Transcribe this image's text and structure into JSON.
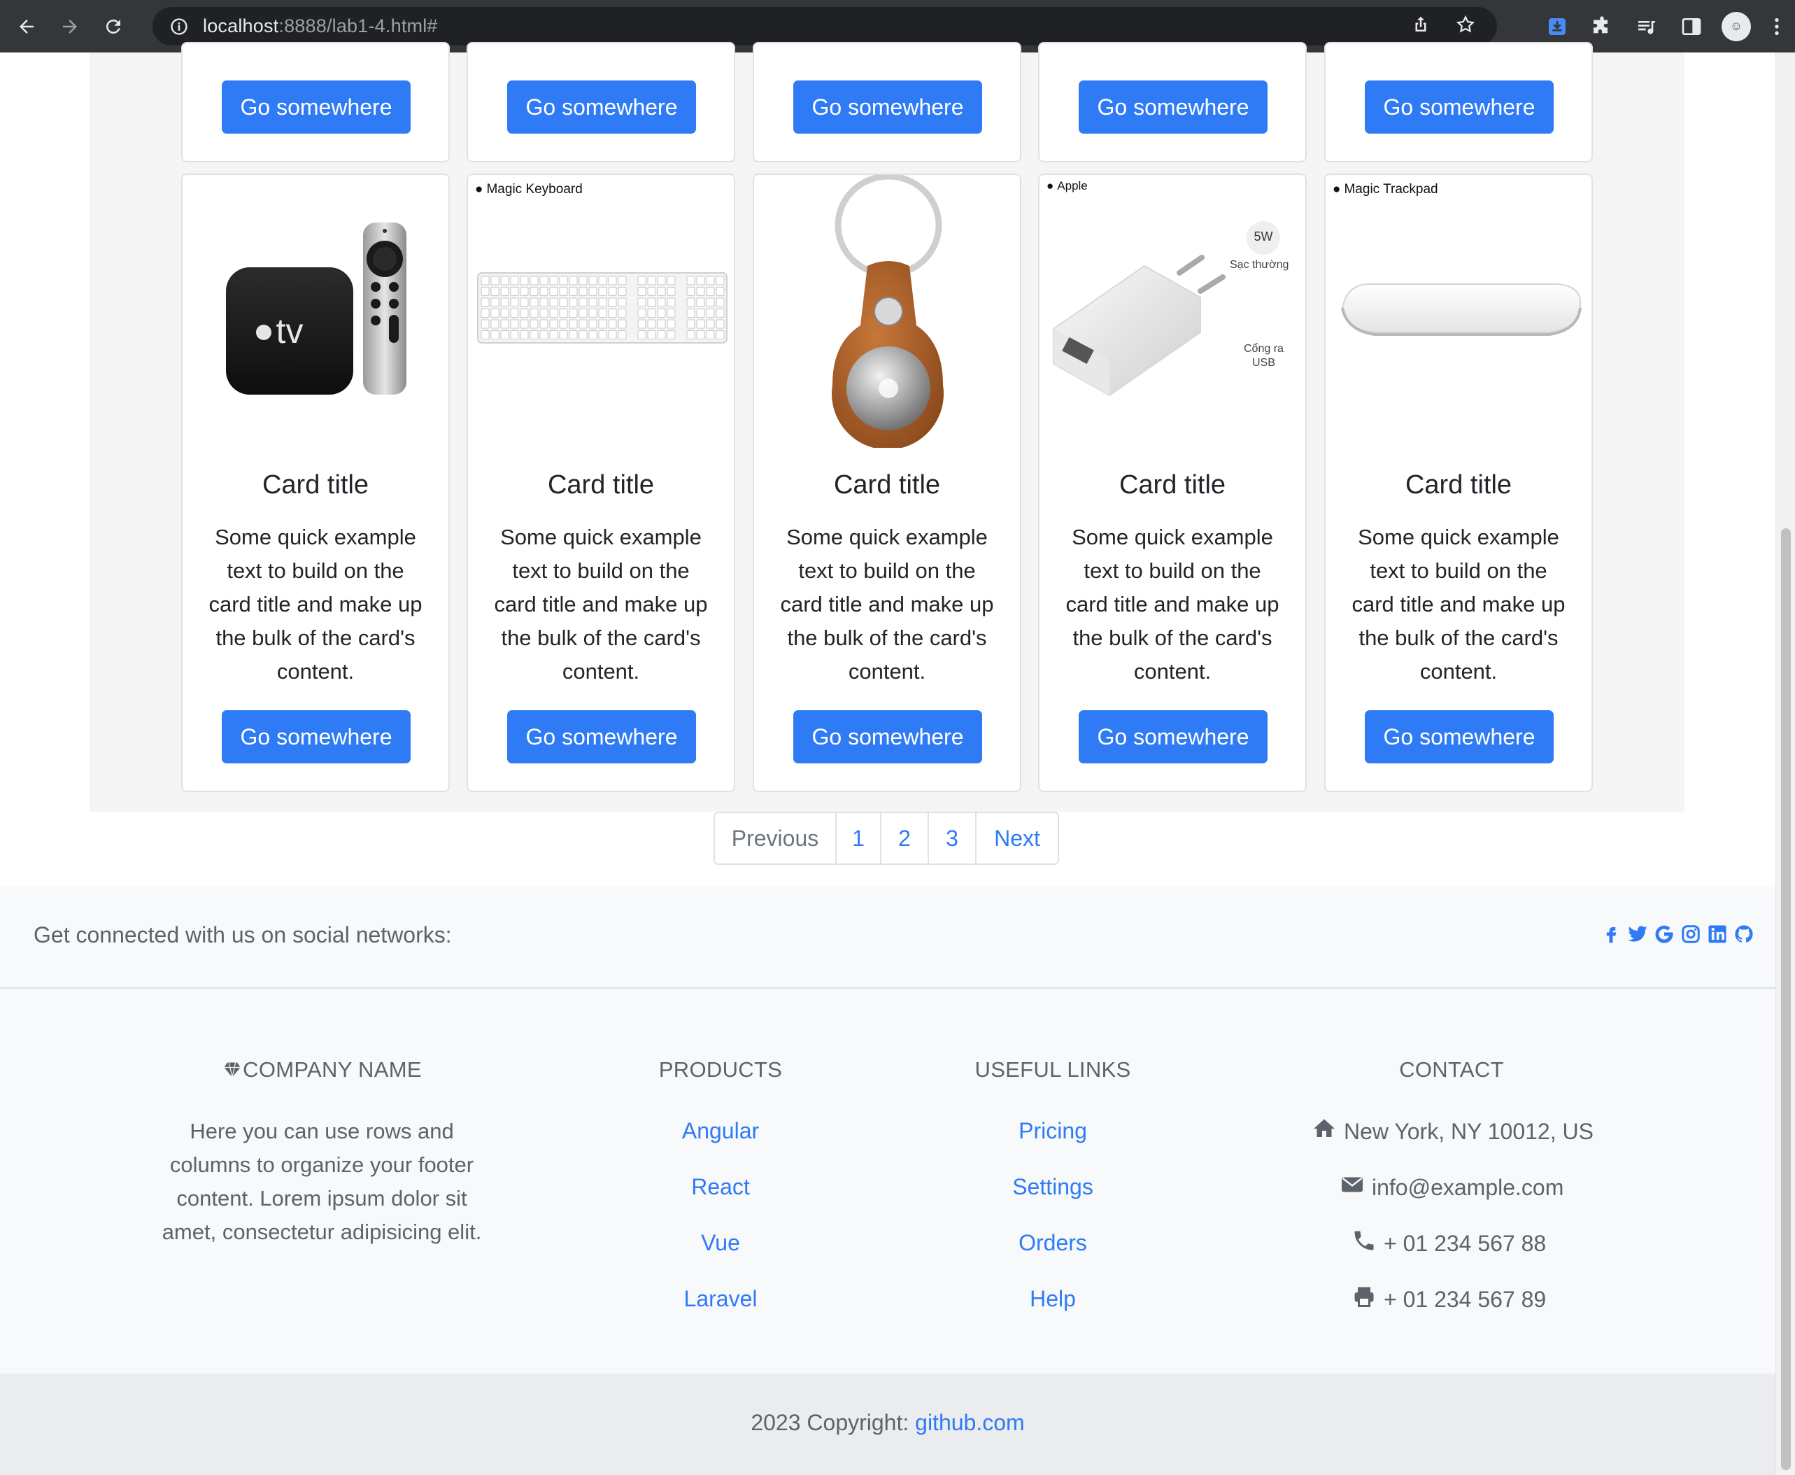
{
  "browser": {
    "url_host": "localhost",
    "url_path": ":8888/lab1-4.html#",
    "icons": [
      "back-icon",
      "forward-icon",
      "reload-icon",
      "info-icon",
      "share-icon",
      "bookmark-star-icon",
      "download-icon",
      "extensions-icon",
      "media-icon",
      "side-panel-icon",
      "profile-avatar",
      "menu-icon"
    ]
  },
  "cards_top_row": {
    "button_label": "Go somewhere"
  },
  "cards": [
    {
      "image": "apple-tv",
      "image_label": "",
      "title": "Card title",
      "text": "Some quick example text to build on the card title and make up the bulk of the card's content.",
      "button": "Go somewhere"
    },
    {
      "image": "magic-keyboard",
      "image_label": "Magic Keyboard",
      "title": "Card title",
      "text": "Some quick example text to build on the card title and make up the bulk of the card's content.",
      "button": "Go somewhere"
    },
    {
      "image": "airtag-keyring",
      "image_label": "",
      "title": "Card title",
      "text": "Some quick example text to build on the card title and make up the bulk of the card's content.",
      "button": "Go somewhere"
    },
    {
      "image": "usb-charger",
      "image_label": "Apple",
      "title": "Card title",
      "text": "Some quick example text to build on the card title and make up the bulk of the card's content.",
      "button": "Go somewhere",
      "charger_badge": "5W",
      "charger_note1": "Sạc thường",
      "charger_note2a": "Cổng ra",
      "charger_note2b": "USB"
    },
    {
      "image": "magic-trackpad",
      "image_label": "Magic Trackpad",
      "title": "Card title",
      "text": "Some quick example text to build on the card title and make up the bulk of the card's content.",
      "button": "Go somewhere"
    }
  ],
  "appletv_logo_text": "tv",
  "pagination": {
    "previous": "Previous",
    "pages": [
      "1",
      "2",
      "3"
    ],
    "next": "Next"
  },
  "footer": {
    "social_text": "Get connected with us on social networks:",
    "social_icons": [
      "facebook-icon",
      "twitter-icon",
      "google-icon",
      "instagram-icon",
      "linkedin-icon",
      "github-icon"
    ],
    "company": {
      "heading": "COMPANY NAME",
      "text": "Here you can use rows and columns to organize your footer content. Lorem ipsum dolor sit amet, consectetur adipisicing elit."
    },
    "products": {
      "heading": "PRODUCTS",
      "links": [
        "Angular",
        "React",
        "Vue",
        "Laravel"
      ]
    },
    "useful_links": {
      "heading": "USEFUL LINKS",
      "links": [
        "Pricing",
        "Settings",
        "Orders",
        "Help"
      ]
    },
    "contact": {
      "heading": "CONTACT",
      "address": "New York, NY 10012, US",
      "email": "info@example.com",
      "phone": "+ 01 234 567 88",
      "fax": "+ 01 234 567 89"
    },
    "copyright_prefix": "2023 Copyright: ",
    "copyright_link": "github.com"
  },
  "colors": {
    "primary": "#2f7bf5",
    "chrome_bg": "#35363a",
    "footer_bg": "#f8f9fa",
    "footer_bottom_bg": "#ebeced",
    "panel_bg": "#f5f5f5"
  }
}
